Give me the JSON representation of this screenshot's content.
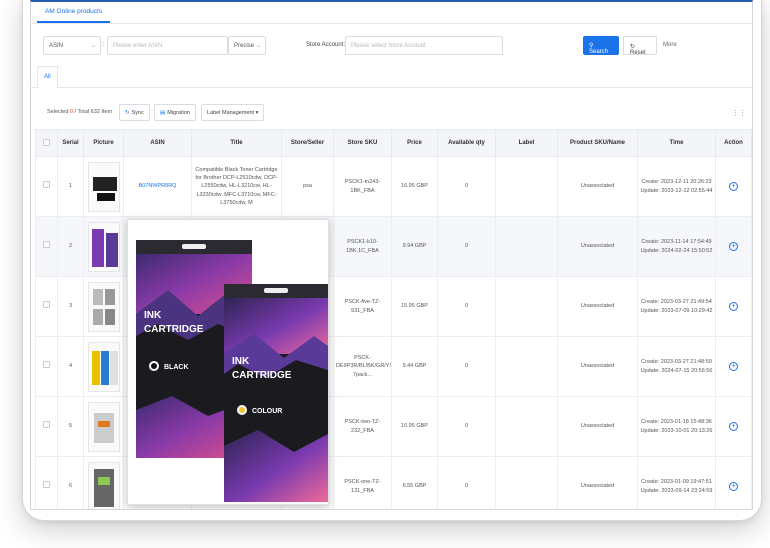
{
  "app": {
    "tab": "AM Online products"
  },
  "filters": {
    "field_select": "ASIN",
    "field_input_placeholder": "Please enter ASIN",
    "match_select": "Precise",
    "store_label": "Store Account:",
    "store_placeholder": "Please select Store Account",
    "search_label": "Search",
    "reset_label": "Reset",
    "more_label": "More"
  },
  "subtabs": {
    "all": "All"
  },
  "toolbar": {
    "selected_prefix": "Selected",
    "selected_count": "0",
    "total_text": "/ Total 632 Item",
    "sync_label": "Sync",
    "migration_label": "Migration",
    "label_mgmt": "Label Management"
  },
  "columns": [
    "Serial",
    "Picture",
    "ASIN",
    "Title",
    "Store/Seller",
    "Store SKU",
    "Price",
    "Available qty",
    "Label",
    "Product SKU/Name",
    "Time",
    "Action"
  ],
  "rows": [
    {
      "serial": "1",
      "asin": "B07NWPR8RQ",
      "title": "Compatible Black Toner Cartridge for Brother DCP-L2510cdw, DCP-L2550cdw, HL-L3210cw, HL-L3230cdw, MFC-L3710cw, MFC-L3750cdw, M",
      "seller": "psa",
      "sku": "PSCK1-tn243-1BK_FBA",
      "price": "16.95 GBP",
      "qty": "0",
      "label": "",
      "product": "Unassociated",
      "create": "Create: 2023-12-11 20:26:23",
      "update": "Update: 2023-12-12 02:55:44"
    },
    {
      "serial": "2",
      "asin": "",
      "title": "",
      "seller": "",
      "sku": "PSCK1-k10-1BK,1C_FBA",
      "price": "9.94 GBP",
      "qty": "0",
      "label": "",
      "product": "Unassociated",
      "create": "Create: 2023-11-14 17:54:49",
      "update": "Update: 2024-02-24 15:50:52"
    },
    {
      "serial": "3",
      "asin": "",
      "title": "",
      "seller": "",
      "sku": "PSCK-five-TZ-931_FBA",
      "price": "15.95 GBP",
      "qty": "0",
      "label": "",
      "product": "Unassociated",
      "create": "Create: 2023-03-27 21:49:54",
      "update": "Update: 2023-07-09 10:29:42"
    },
    {
      "serial": "4",
      "asin": "",
      "title": "",
      "seller": "",
      "sku": "PSCK-DE9P3R/BL/BK/GR/Y/CL/SIL-7pack...",
      "price": "9.44 GBP",
      "qty": "0",
      "label": "",
      "product": "Unassociated",
      "create": "Create: 2023-03-27 21:48:59",
      "update": "Update: 2024-07-15 20:56:56"
    },
    {
      "serial": "5",
      "asin": "",
      "title": "",
      "seller": "",
      "sku": "PSCK-two-TZ-232_FBA",
      "price": "10.95 GBP",
      "qty": "0",
      "label": "",
      "product": "Unassociated",
      "create": "Create: 2023-01-18 15:48:36",
      "update": "Update: 2023-10-01 20:13:26"
    },
    {
      "serial": "6",
      "asin": "",
      "title": "",
      "seller": "",
      "sku": "PSCK-one-TZ-131_FBA",
      "price": "6.55 GBP",
      "qty": "0",
      "label": "",
      "product": "Unassociated",
      "create": "Create: 2023-01-09 19:47:51",
      "update": "Update: 2023-09-14 23:24:59"
    }
  ],
  "popup": {
    "box1_line1": "INK",
    "box1_line2": "CARTRIDGE",
    "box1_color": "BLACK",
    "box2_line1": "INK",
    "box2_line2": "CARTRIDGE",
    "box2_color": "COLOUR"
  },
  "colors": {
    "accent": "#1a73e8",
    "selected_count": "#e53935"
  }
}
